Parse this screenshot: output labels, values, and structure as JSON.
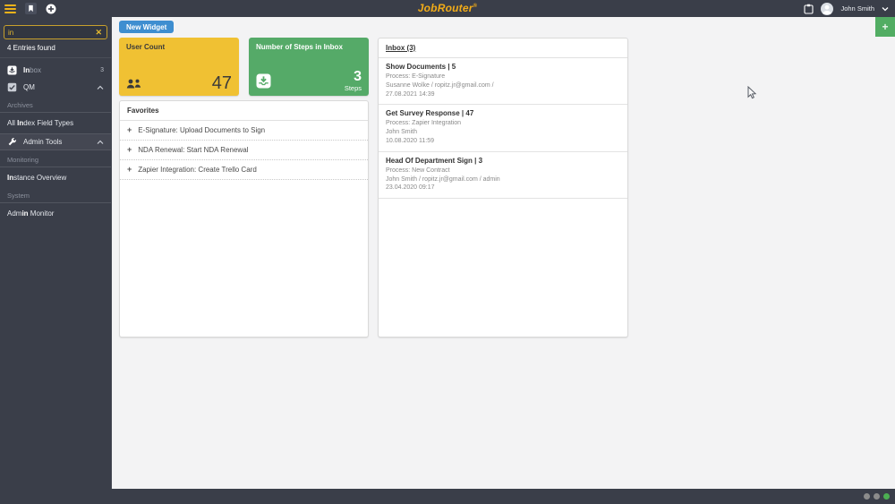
{
  "topbar": {
    "logo": "JobRouter",
    "logo_mark": "®",
    "user_name": "John Smith"
  },
  "sidebar": {
    "search": {
      "value": "in",
      "clear_icon": "✕"
    },
    "results_text": "4 Entries found",
    "inbox_item": {
      "pre": "",
      "match": "In",
      "post": "box",
      "badge": "3"
    },
    "qm_item": {
      "label": "QM"
    },
    "sections": {
      "archives": "Archives",
      "monitoring": "Monitoring",
      "system": "System"
    },
    "index_field_types_item": {
      "pre": "All ",
      "match": "In",
      "post": "dex Field Types"
    },
    "admin_tools_item": {
      "label": "Admin Tools"
    },
    "instance_overview_item": {
      "pre": "",
      "match": "In",
      "post": "stance Overview"
    },
    "admin_monitor_item": {
      "pre": "Adm",
      "match": "in",
      "post": " Monitor"
    }
  },
  "content": {
    "new_widget_button": "New Widget",
    "add_widget_button": "+",
    "widgets": {
      "user_count": {
        "title": "User Count",
        "value": "47"
      },
      "steps_in_inbox": {
        "title": "Number of Steps in Inbox",
        "value": "3",
        "unit": "Steps"
      },
      "favorites": {
        "title": "Favorites",
        "items": [
          "E-Signature: Upload Documents to Sign",
          "NDA Renewal: Start NDA Renewal",
          "Zapier Integration: Create Trello Card"
        ],
        "plus_icon": "+"
      },
      "inbox": {
        "title": "Inbox (3)",
        "entries": [
          {
            "title": "Show Documents | 5",
            "process": "Process: E-Signature",
            "user": "Susanne Wolke / ropitz.jr@gmail.com /",
            "date": "27.08.2021 14:39"
          },
          {
            "title": "Get Survey Response | 47",
            "process": "Process: Zapier Integration",
            "user": "John Smith",
            "date": "10.08.2020 11:59"
          },
          {
            "title": "Head Of Department Sign | 3",
            "process": "Process: New Contract",
            "user": "John Smith / ropitz.jr@gmail.com / admin",
            "date": "23.04.2020 09:17"
          }
        ]
      }
    }
  },
  "colors": {
    "topbar_bg": "#3a3e49",
    "accent_yellow": "#f2ac18",
    "search_border_yellow": "#c7a02c",
    "tile_yellow": "#f0c133",
    "tile_green": "#55aa68",
    "button_blue": "#3e8ed0",
    "add_button_green": "#52ad63",
    "content_bg": "#f3f3f4",
    "footer_dot_green": "#4cae52",
    "footer_dot_gray": "#8c8c8c"
  }
}
